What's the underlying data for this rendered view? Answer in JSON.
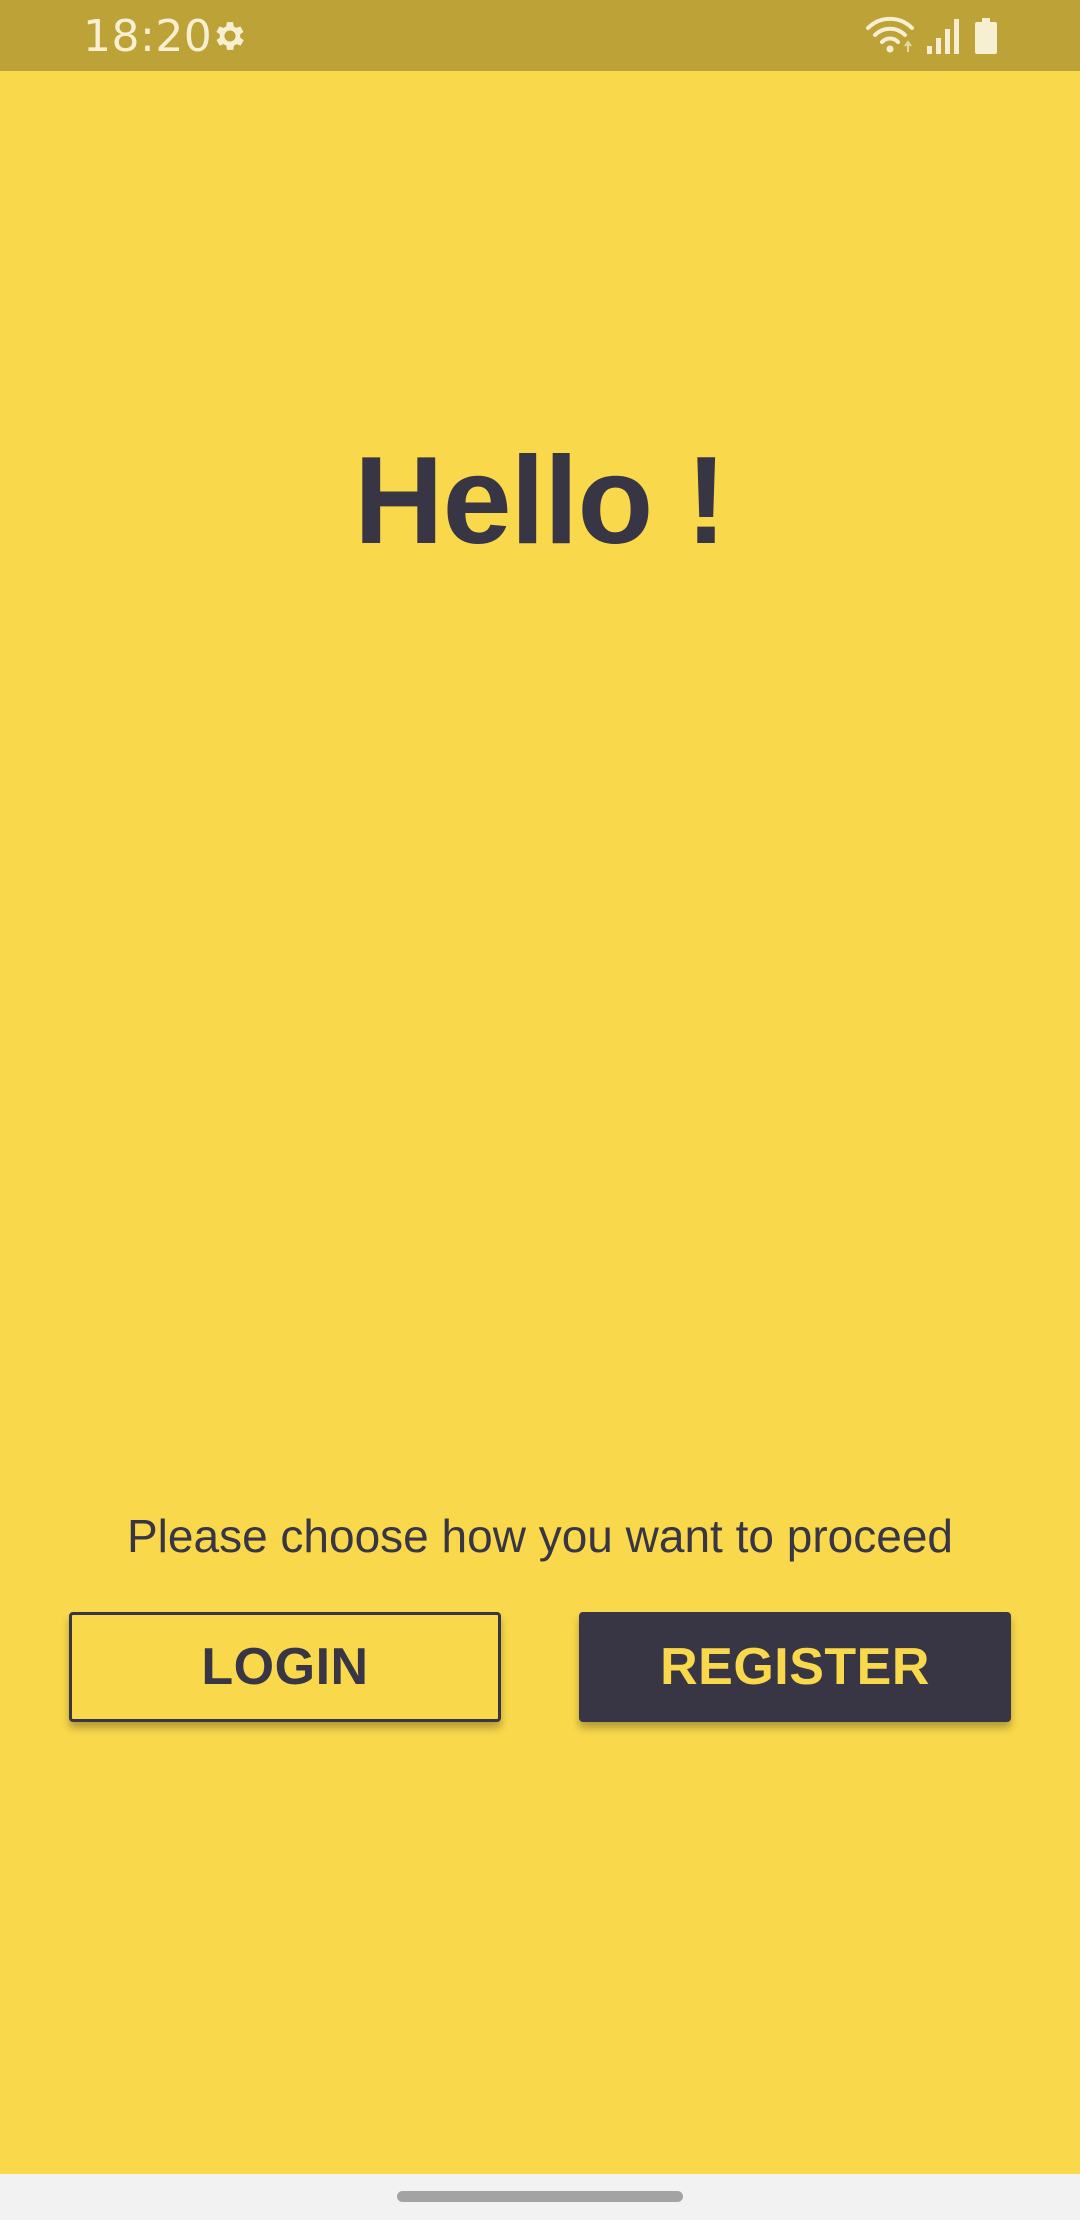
{
  "status_bar": {
    "time": "18:20",
    "icons": [
      "settings-icon",
      "wifi-icon",
      "signal-icon",
      "battery-icon"
    ]
  },
  "main": {
    "greeting": "Hello !",
    "prompt": "Please choose how you want to proceed",
    "login_label": "LOGIN",
    "register_label": "REGISTER"
  },
  "colors": {
    "background": "#F9D84B",
    "status_bar": "#BCA237",
    "primary_dark": "#383645",
    "nav_bar": "#F2F2F2"
  }
}
